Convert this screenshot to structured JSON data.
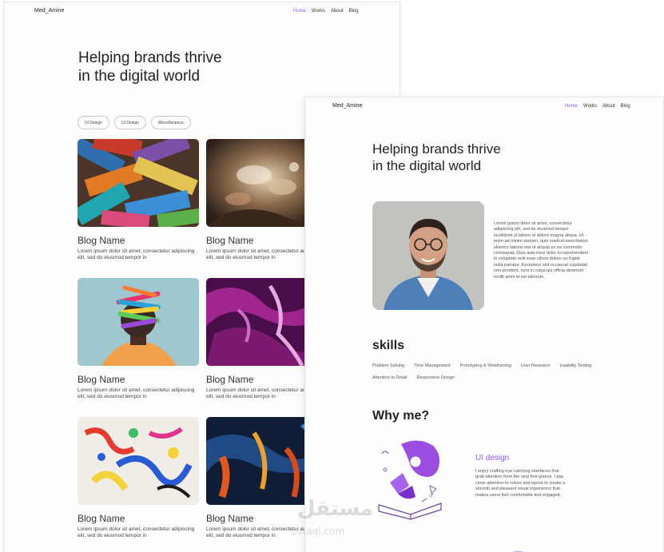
{
  "back_page": {
    "nav": {
      "logo": "Med_Amine",
      "links": [
        "Home",
        "Works",
        "About",
        "Blog"
      ]
    },
    "hero": {
      "line1": "Helping brands thrive",
      "line2": "in the digital world"
    },
    "filters": [
      "UI Design",
      "UI Design",
      "Miscellaneous"
    ],
    "cards": [
      {
        "name": "Blog Name",
        "desc": "Lorem ipsum dolor sit amet, consectetur adipiscing elit, sed do eiusmod tempor in"
      },
      {
        "name": "Blog Name",
        "desc": "Lorem ipsum dolor sit amet, consectetur adipiscing elit, sed do eiusmod tempor in"
      },
      {
        "name": "Blog Name",
        "desc": "Lorem ipsum dolor sit amet, consectetur adipiscing elit, sed do eiusmod tempor in"
      },
      {
        "name": "Blog Name",
        "desc": "Lorem ipsum dolor sit amet, consectetur adipiscing elit, sed do eiusmod tempor in"
      },
      {
        "name": "Blog Name",
        "desc": "Lorem ipsum dolor sit amet, consectetur adipiscing elit, sed do eiusmod tempor in"
      },
      {
        "name": "Blog Name",
        "desc": "Lorem ipsum dolor sit amet, consectetur adipiscing elit, sed do eiusmod tempor in"
      }
    ]
  },
  "front_page": {
    "nav": {
      "logo": "Med_Amine",
      "links": [
        "Home",
        "Works",
        "About",
        "Blog"
      ]
    },
    "hero": {
      "line1": "Helping brands thrive",
      "line2": "in the digital world"
    },
    "bio": "Lorem ipsum dolor sit amet, consectetur adipiscing elit, sed do eiusmod tempor incididunt ut labore et dolore magna aliqua. Ut enim ad minim veniam, quis nostrud exercitation ullamco laboris nisi ut aliquip ex ea commodo consequat. Duis aute irure dolor in reprehenderit in voluptate velit esse cillum dolore eu fugiat nulla pariatur. Excepteur sint occaecat cupidatat non proident, sunt in culpa qui officia deserunt mollit anim id est laborum.",
    "skills_title": "skills",
    "skills": [
      "Problem Solving",
      "Time Management",
      "Prototyping & Wireframing",
      "User Research",
      "Usability Testing",
      "Attention to Detail",
      "Responsive Design"
    ],
    "why_title": "Why me?",
    "why_item": {
      "title": "UI design",
      "desc": "I enjoy crafting eye-catching interfaces that grab attention from the very first glance. I pay close attention to colors and layout to create a smooth and pleasant visual experience that makes users feel comfortable and engaged."
    }
  },
  "watermark": {
    "arabic": "مستقل",
    "latin": "ostaql.com"
  },
  "colors": {
    "accent": "#8b5cf6",
    "text": "#222222",
    "muted": "#555555"
  }
}
